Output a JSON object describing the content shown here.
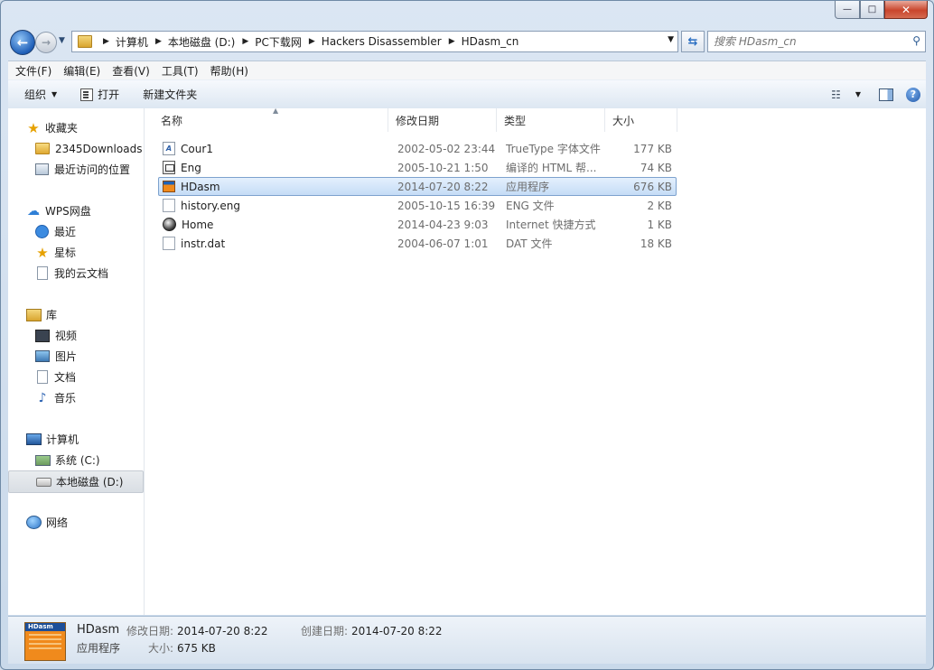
{
  "window": {
    "min_glyph": "—",
    "max_glyph": "□",
    "close_glyph": "✕"
  },
  "address": {
    "crumbs": [
      "计算机",
      "本地磁盘 (D:)",
      "PC下载网",
      "Hackers Disassembler",
      "HDasm_cn"
    ]
  },
  "search": {
    "placeholder": "搜索 HDasm_cn"
  },
  "menu": [
    "文件(F)",
    "编辑(E)",
    "查看(V)",
    "工具(T)",
    "帮助(H)"
  ],
  "toolbar": {
    "organize": "组织",
    "open": "打开",
    "new_folder": "新建文件夹"
  },
  "nav": {
    "favorites": {
      "label": "收藏夹",
      "items": [
        "2345Downloads",
        "最近访问的位置"
      ]
    },
    "wps": {
      "label": "WPS网盘",
      "items": [
        "最近",
        "星标",
        "我的云文档"
      ]
    },
    "library": {
      "label": "库",
      "items": [
        "视频",
        "图片",
        "文档",
        "音乐"
      ]
    },
    "computer": {
      "label": "计算机",
      "items": [
        "系统 (C:)",
        "本地磁盘 (D:)"
      ]
    },
    "network": {
      "label": "网络"
    }
  },
  "columns": {
    "name": "名称",
    "date": "修改日期",
    "type": "类型",
    "size": "大小"
  },
  "files": [
    {
      "name": "Cour1",
      "date": "2002-05-02 23:44",
      "type": "TrueType 字体文件",
      "size": "177 KB",
      "icon": "font-file-icon"
    },
    {
      "name": "Eng",
      "date": "2005-10-21 1:50",
      "type": "编译的 HTML 帮...",
      "size": "74 KB",
      "icon": "chm-file-icon"
    },
    {
      "name": "HDasm",
      "date": "2014-07-20 8:22",
      "type": "应用程序",
      "size": "676 KB",
      "icon": "exe-file-icon"
    },
    {
      "name": "history.eng",
      "date": "2005-10-15 16:39",
      "type": "ENG 文件",
      "size": "2 KB",
      "icon": "blank-file-icon"
    },
    {
      "name": "Home",
      "date": "2014-04-23 9:03",
      "type": "Internet 快捷方式",
      "size": "1 KB",
      "icon": "url-shortcut-icon"
    },
    {
      "name": "instr.dat",
      "date": "2004-06-07 1:01",
      "type": "DAT 文件",
      "size": "18 KB",
      "icon": "blank-file-icon"
    }
  ],
  "details": {
    "thumb_label": "HDasm",
    "name": "HDasm",
    "type": "应用程序",
    "modified_label": "修改日期:",
    "modified": "2014-07-20 8:22",
    "created_label": "创建日期:",
    "created": "2014-07-20 8:22",
    "size_label": "大小:",
    "size": "675 KB"
  }
}
